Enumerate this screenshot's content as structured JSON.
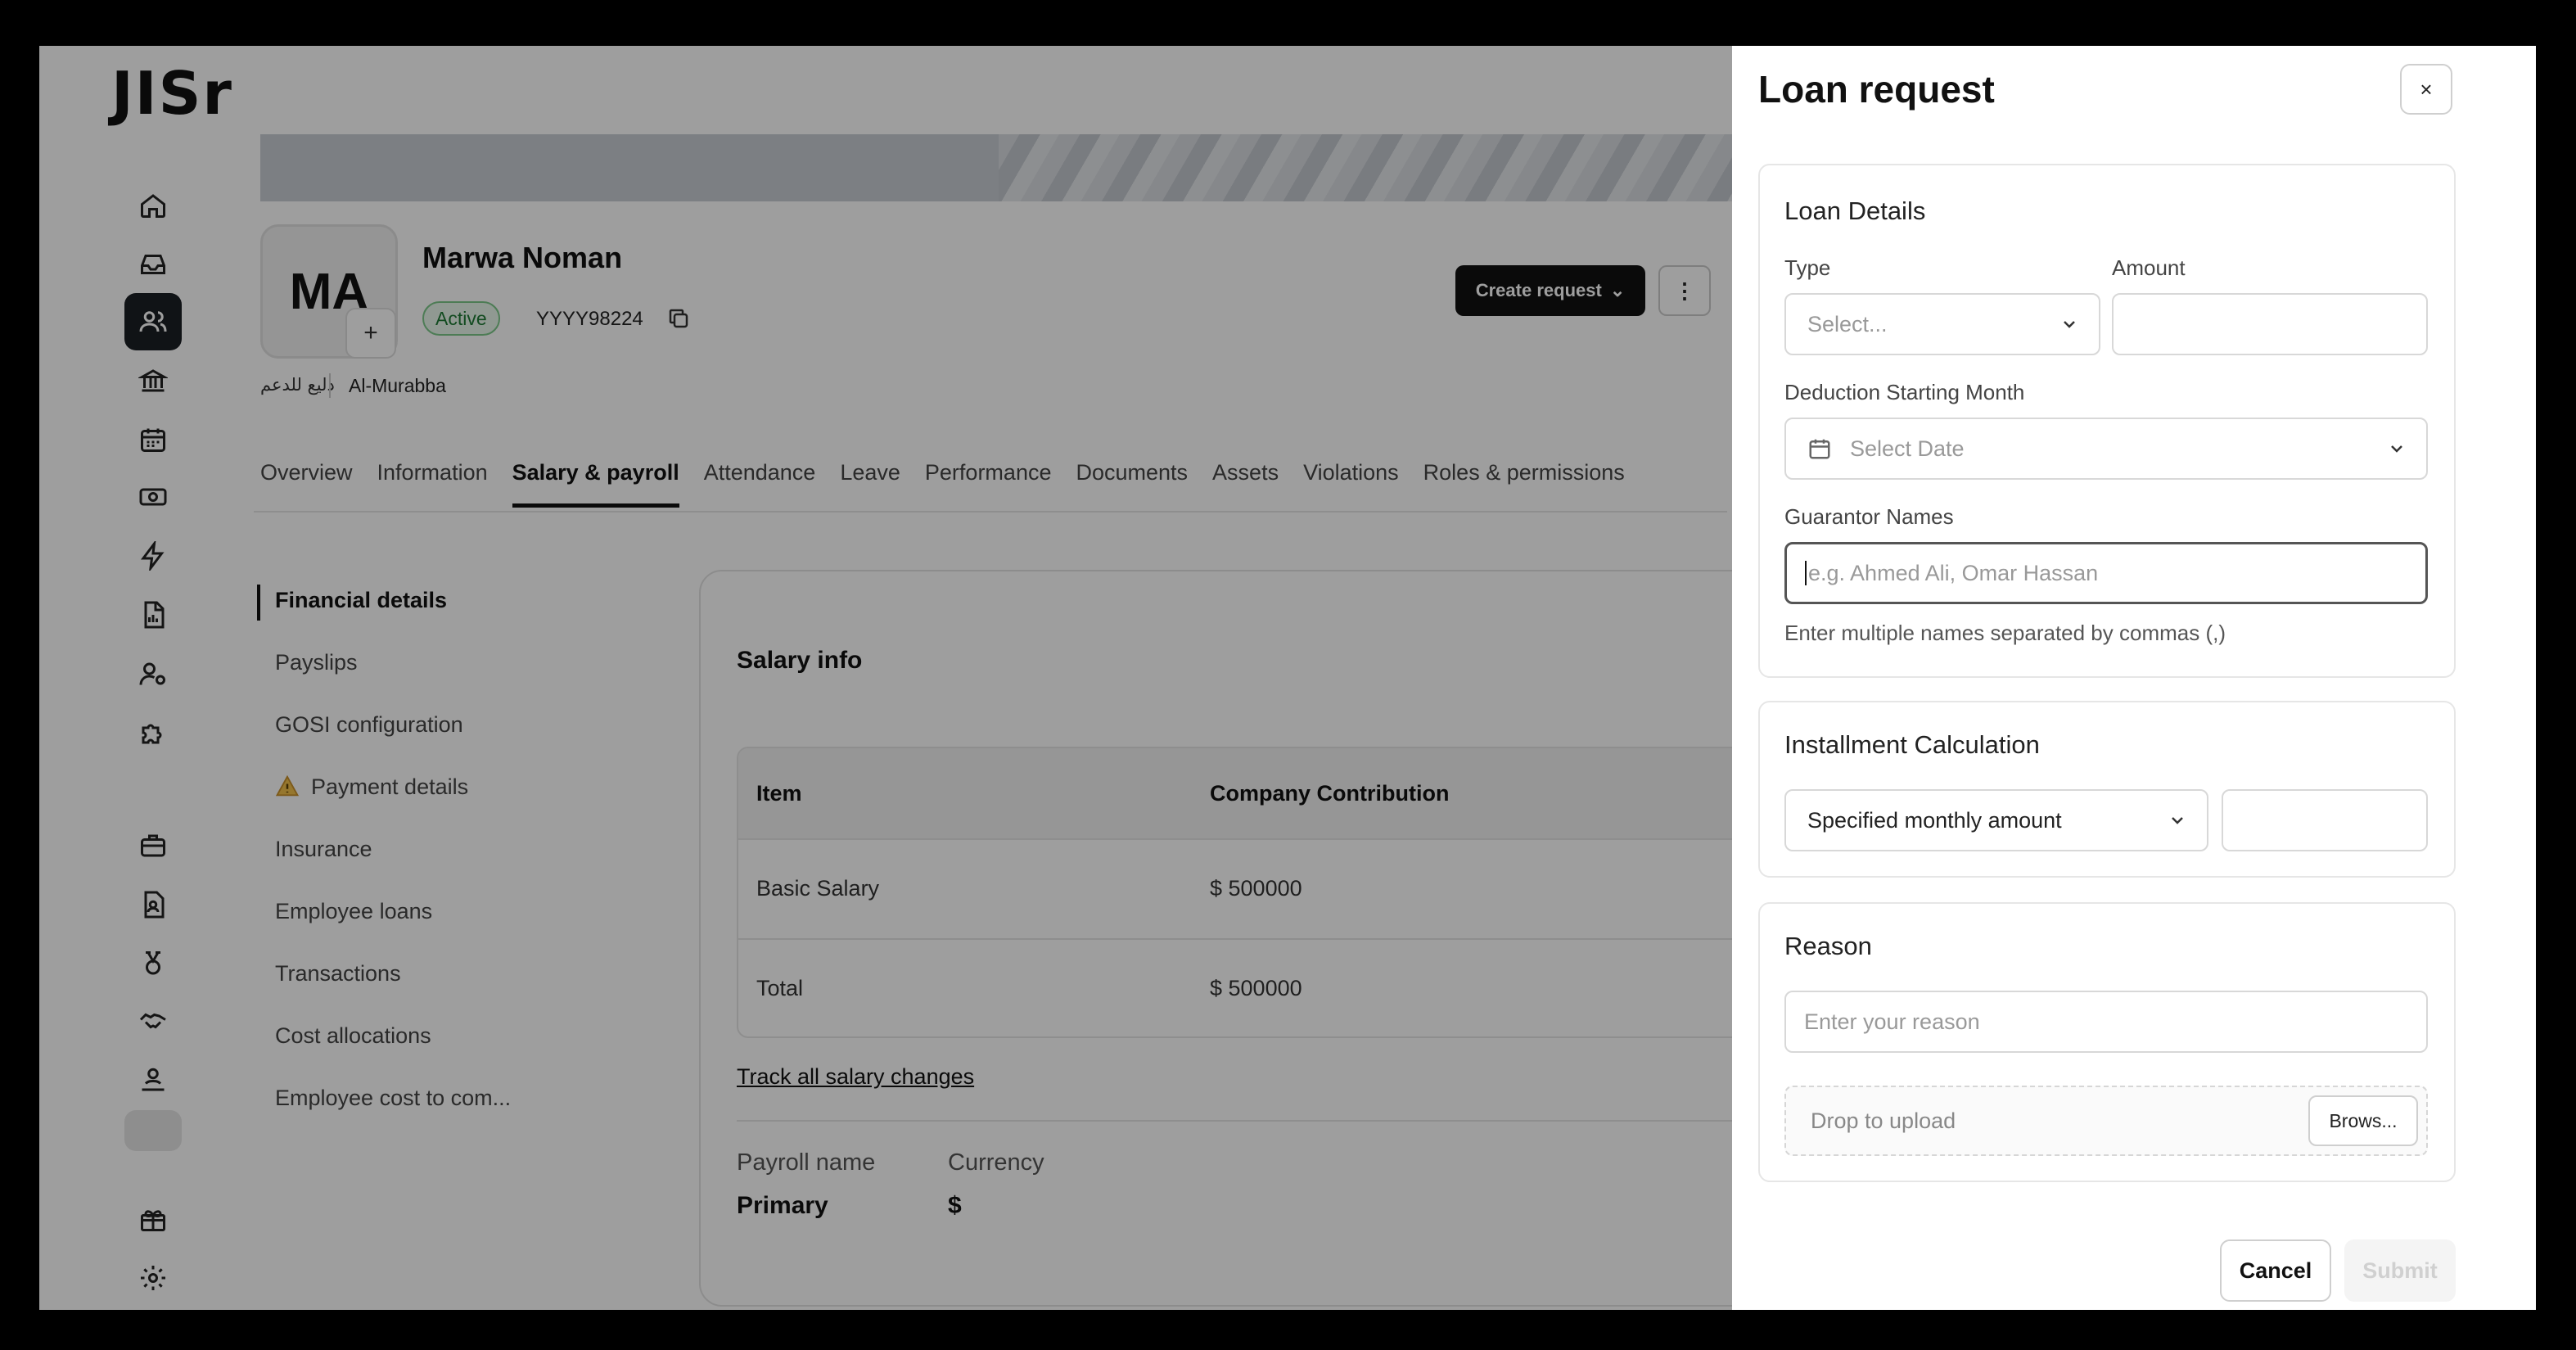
{
  "app": {
    "logo": "JISr"
  },
  "rail": {
    "icons": [
      "home-icon",
      "inbox-icon",
      "users-icon",
      "bank-icon",
      "calendar-icon",
      "money-icon",
      "flash-icon",
      "report-icon",
      "user-key-icon",
      "puzzle-icon",
      "briefcase-icon",
      "document-user-icon",
      "medal-icon",
      "handshake-icon",
      "user-hand-icon",
      "placeholder",
      "gift-icon",
      "settings-icon"
    ],
    "active": "users-icon"
  },
  "profile": {
    "initials": "MA",
    "add_label": "+",
    "name": "Marwa Noman",
    "status": "Active",
    "employee_id": "YYYY98224",
    "arabic_label": "دليع للدعم",
    "location": "Al-Murabba"
  },
  "header_actions": {
    "create_request": "Create request",
    "more": "⋮"
  },
  "tabs": [
    {
      "label": "Overview"
    },
    {
      "label": "Information"
    },
    {
      "label": "Salary & payroll",
      "active": true
    },
    {
      "label": "Attendance"
    },
    {
      "label": "Leave"
    },
    {
      "label": "Performance"
    },
    {
      "label": "Documents"
    },
    {
      "label": "Assets"
    },
    {
      "label": "Violations"
    },
    {
      "label": "Roles & permissions"
    }
  ],
  "submenu": [
    {
      "label": "Financial details",
      "active": true
    },
    {
      "label": "Payslips"
    },
    {
      "label": "GOSI configuration"
    },
    {
      "label": "Payment details",
      "warning": true
    },
    {
      "label": "Insurance"
    },
    {
      "label": "Employee loans"
    },
    {
      "label": "Transactions"
    },
    {
      "label": "Cost allocations"
    },
    {
      "label": "Employee cost to com..."
    }
  ],
  "salary": {
    "title": "Salary info",
    "columns": [
      "Item",
      "Company Contribution"
    ],
    "rows": [
      {
        "item": "Basic Salary",
        "value": "$ 500000"
      },
      {
        "item": "Total",
        "value": "$ 500000"
      }
    ],
    "track_link": "Track all salary changes",
    "payroll_label": "Payroll name",
    "payroll_value": "Primary",
    "currency_label": "Currency",
    "currency_value": "$"
  },
  "drawer": {
    "title": "Loan request",
    "close": "×",
    "loan_details": {
      "title": "Loan Details",
      "type_label": "Type",
      "type_placeholder": "Select...",
      "amount_label": "Amount",
      "amount_value": "",
      "deduction_label": "Deduction Starting Month",
      "date_placeholder": "Select Date",
      "guarantor_label": "Guarantor Names",
      "guarantor_placeholder": "e.g. Ahmed Ali, Omar Hassan",
      "guarantor_helper": "Enter multiple names separated by commas (,)"
    },
    "installment": {
      "title": "Installment Calculation",
      "method": "Specified monthly amount",
      "value": ""
    },
    "reason": {
      "title": "Reason",
      "placeholder": "Enter your reason",
      "drop_text": "Drop to upload",
      "browse": "Brows..."
    },
    "cancel": "Cancel",
    "submit": "Submit"
  }
}
